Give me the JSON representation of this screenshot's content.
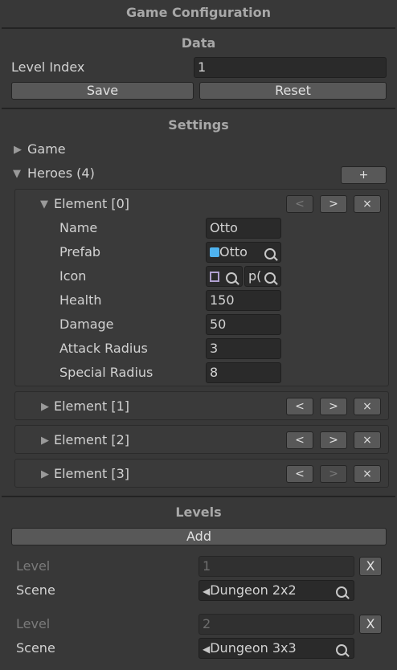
{
  "window": {
    "title": "Game Configuration"
  },
  "data": {
    "header": "Data",
    "level_index_label": "Level Index",
    "level_index_value": "1",
    "save_label": "Save",
    "reset_label": "Reset"
  },
  "settings": {
    "header": "Settings",
    "game_label": "Game",
    "heroes_label": "Heroes (4)",
    "add_label": "+",
    "element0": {
      "label": "Element [0]",
      "prev": "<",
      "next": ">",
      "remove": "×",
      "fields": {
        "name_label": "Name",
        "name_value": "Otto",
        "prefab_label": "Prefab",
        "prefab_value": "Otto",
        "icon_label": "Icon",
        "icon_value": "p(",
        "health_label": "Health",
        "health_value": "150",
        "damage_label": "Damage",
        "damage_value": "50",
        "attack_label": "Attack Radius",
        "attack_value": "3",
        "special_label": "Special Radius",
        "special_value": "8"
      }
    },
    "elements": [
      {
        "label": "Element [1]",
        "prev": "<",
        "next": ">",
        "remove": "×"
      },
      {
        "label": "Element [2]",
        "prev": "<",
        "next": ">",
        "remove": "×"
      },
      {
        "label": "Element [3]",
        "prev": "<",
        "next": ">",
        "remove": "×"
      }
    ]
  },
  "levels": {
    "header": "Levels",
    "add_label": "Add",
    "items": [
      {
        "level_label": "Level",
        "level_value": "1",
        "remove": "X",
        "scene_label": "Scene",
        "scene_value": "Dungeon 2x2"
      },
      {
        "level_label": "Level",
        "level_value": "2",
        "remove": "X",
        "scene_label": "Scene",
        "scene_value": "Dungeon 3x3"
      }
    ]
  },
  "colors": {
    "background": "#383838",
    "field": "#2a2a2a",
    "button": "#585858",
    "header_text": "#a8a8a8",
    "prefab_icon": "#4fb3f0"
  },
  "icons": [
    "cube-icon",
    "sprite-icon",
    "object-picker-icon",
    "scene-icon"
  ]
}
